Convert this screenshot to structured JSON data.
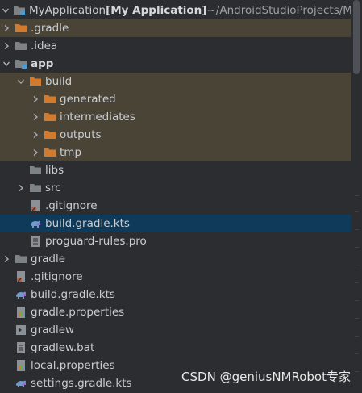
{
  "project": {
    "name": "MyApplication",
    "module": "[My Application]",
    "path": "~/AndroidStudioProjects/My"
  },
  "tree": [
    {
      "label": "MyApplication",
      "chevron": "down",
      "icon": "module-folder-icon",
      "indent": 0,
      "bg": "none",
      "type": "header"
    },
    {
      "label": ".gradle",
      "chevron": "right",
      "icon": "folder-orange-icon",
      "indent": 0,
      "bg": "tan"
    },
    {
      "label": ".idea",
      "chevron": "right",
      "icon": "folder-gray-icon",
      "indent": 0,
      "bg": "none"
    },
    {
      "label": "app",
      "chevron": "down",
      "icon": "module-folder-icon",
      "indent": 0,
      "bg": "none",
      "bold": true
    },
    {
      "label": "build",
      "chevron": "down",
      "icon": "folder-orange-icon",
      "indent": 1,
      "bg": "tan"
    },
    {
      "label": "generated",
      "chevron": "right",
      "icon": "folder-orange-icon",
      "indent": 2,
      "bg": "tan"
    },
    {
      "label": "intermediates",
      "chevron": "right",
      "icon": "folder-orange-icon",
      "indent": 2,
      "bg": "tan"
    },
    {
      "label": "outputs",
      "chevron": "right",
      "icon": "folder-orange-icon",
      "indent": 2,
      "bg": "tan"
    },
    {
      "label": "tmp",
      "chevron": "right",
      "icon": "folder-orange-icon",
      "indent": 2,
      "bg": "tan"
    },
    {
      "label": "libs",
      "chevron": "none",
      "icon": "folder-gray-icon",
      "indent": 1,
      "bg": "none"
    },
    {
      "label": "src",
      "chevron": "right",
      "icon": "folder-gray-icon",
      "indent": 1,
      "bg": "none"
    },
    {
      "label": ".gitignore",
      "chevron": "none",
      "icon": "gitignore-file-icon",
      "indent": 1,
      "bg": "none"
    },
    {
      "label": "build.gradle.kts",
      "chevron": "none",
      "icon": "gradle-kts-file-icon",
      "indent": 1,
      "bg": "sel"
    },
    {
      "label": "proguard-rules.pro",
      "chevron": "none",
      "icon": "text-file-icon",
      "indent": 1,
      "bg": "none"
    },
    {
      "label": "gradle",
      "chevron": "right",
      "icon": "folder-gray-icon",
      "indent": 0,
      "bg": "none"
    },
    {
      "label": ".gitignore",
      "chevron": "none",
      "icon": "gitignore-file-icon",
      "indent": 0,
      "bg": "none"
    },
    {
      "label": "build.gradle.kts",
      "chevron": "none",
      "icon": "gradle-kts-file-icon",
      "indent": 0,
      "bg": "none"
    },
    {
      "label": "gradle.properties",
      "chevron": "none",
      "icon": "properties-file-icon",
      "indent": 0,
      "bg": "none"
    },
    {
      "label": "gradlew",
      "chevron": "none",
      "icon": "script-file-icon",
      "indent": 0,
      "bg": "none"
    },
    {
      "label": "gradlew.bat",
      "chevron": "none",
      "icon": "text-file-icon",
      "indent": 0,
      "bg": "none"
    },
    {
      "label": "local.properties",
      "chevron": "none",
      "icon": "properties-file-icon",
      "indent": 0,
      "bg": "none"
    },
    {
      "label": "settings.gradle.kts",
      "chevron": "none",
      "icon": "gradle-kts-file-icon",
      "indent": 0,
      "bg": "none"
    }
  ],
  "watermark": "CSDN @geniusNMRobot专家",
  "colors": {
    "panel_bg": "#2b2d30",
    "build_highlight": "#4a4436",
    "selection": "#0f3a5a",
    "folder_orange": "#d27a2e",
    "folder_gray": "#7d8287"
  }
}
